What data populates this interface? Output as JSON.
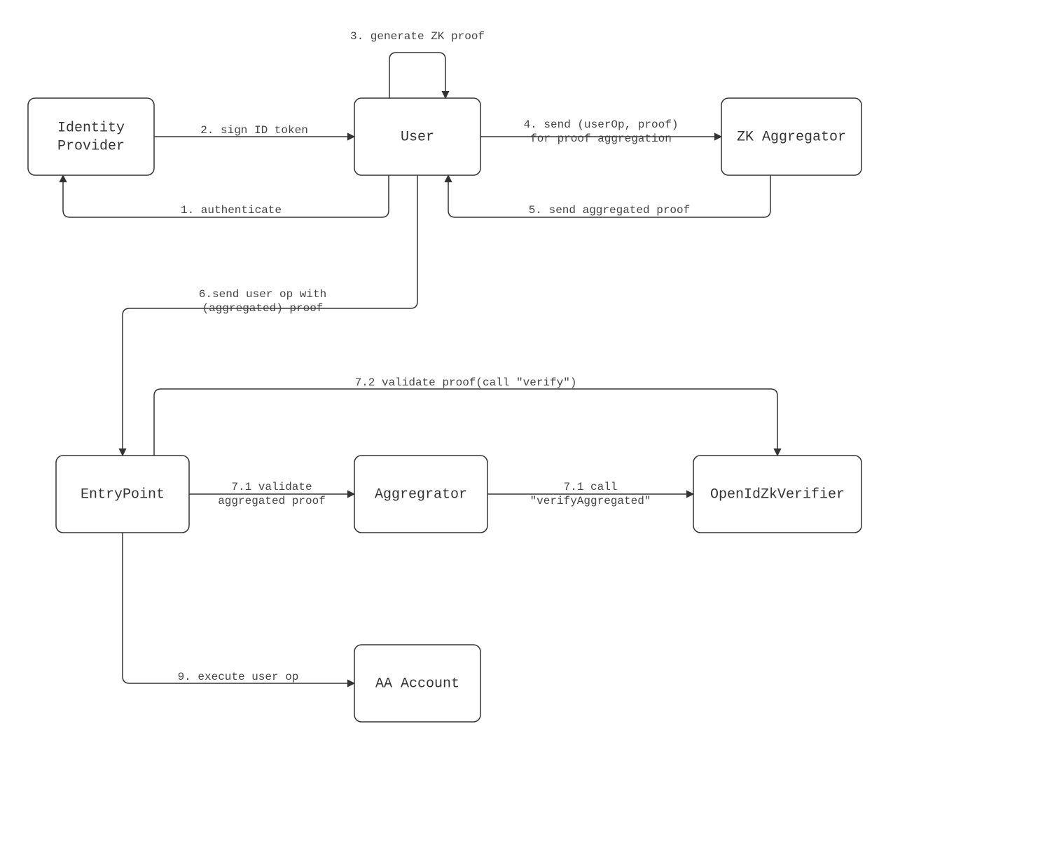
{
  "nodes": {
    "identity_provider": {
      "line1": "Identity",
      "line2": "Provider"
    },
    "user": "User",
    "zk_aggregator": "ZK Aggregator",
    "entrypoint": "EntryPoint",
    "aggregator": "Aggregrator",
    "verifier": "OpenIdZkVerifier",
    "aa_account": "AA Account"
  },
  "edges": {
    "e1": "1. authenticate",
    "e2": "2. sign ID token",
    "e3": "3. generate ZK proof",
    "e4a": "4. send (userOp, proof)",
    "e4b": "for proof aggregation",
    "e5": "5. send aggregated proof",
    "e6a": "6.send user op with",
    "e6b": "(aggregated) proof",
    "e71a": "7.1 validate",
    "e71b": "aggregated proof",
    "e71ca": "7.1 call",
    "e71cb": "\"verifyAggregated\"",
    "e72": "7.2 validate proof(call \"verify\")",
    "e9": "9. execute user op"
  }
}
